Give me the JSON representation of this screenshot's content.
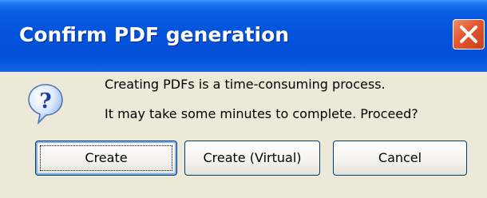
{
  "window": {
    "title": "Confirm PDF generation"
  },
  "message": {
    "line1": "Creating PDFs is a time-consuming process.",
    "line2": "It may take some minutes to complete. Proceed?"
  },
  "icons": {
    "question": "question-icon",
    "close": "close-icon"
  },
  "buttons": {
    "create_label": "Create",
    "create_virtual_label": "Create (Virtual)",
    "cancel_label": "Cancel"
  },
  "colors": {
    "titlebar_blue": "#0453dc",
    "close_red": "#e2572e",
    "dialog_background": "#ece9d8"
  }
}
